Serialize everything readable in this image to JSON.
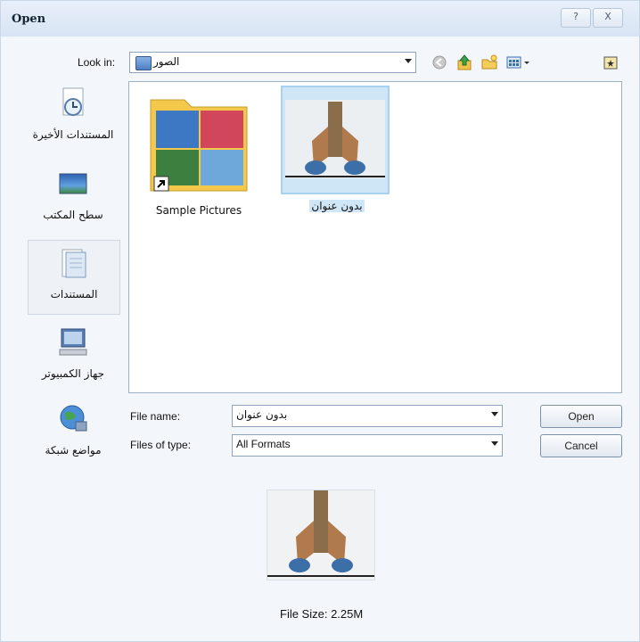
{
  "window": {
    "title": "Open",
    "help_label": "?",
    "close_label": "X"
  },
  "look_in": {
    "label": "Look in:",
    "value": "الصور"
  },
  "toolbar": {
    "icons": [
      "back-icon",
      "up-folder-icon",
      "new-folder-icon",
      "view-menu-icon",
      "desktop-shortcut-icon"
    ]
  },
  "places": [
    {
      "label": "المستندات الأخيرة",
      "icon": "recent-documents-icon"
    },
    {
      "label": "سطح المكتب",
      "icon": "desktop-icon"
    },
    {
      "label": "المستندات",
      "icon": "documents-icon",
      "selected": true
    },
    {
      "label": "جهاز الكمبيوتر",
      "icon": "computer-icon"
    },
    {
      "label": "مواضع شبكة",
      "icon": "network-icon"
    }
  ],
  "files": [
    {
      "name": "Sample Pictures",
      "type": "folder-shortcut"
    },
    {
      "name": "بدون عنوان",
      "type": "image",
      "selected": true
    }
  ],
  "file_name": {
    "label": "File name:",
    "value": "بدون عنوان"
  },
  "file_type": {
    "label": "Files of type:",
    "value": "All Formats"
  },
  "buttons": {
    "open": "Open",
    "cancel": "Cancel"
  },
  "preview": {
    "file_size": "File Size: 2.25M"
  },
  "colors": {
    "selection": "#cfe6f7",
    "folder": "#f4c84a"
  }
}
